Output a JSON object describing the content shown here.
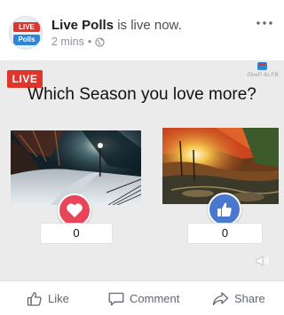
{
  "header": {
    "avatar": {
      "line1": "LIVE",
      "line2": "Polls"
    },
    "page_name": "Live Polls",
    "status_text": " is live now.",
    "time_ago": "2 mins",
    "separator": "•",
    "privacy_icon": "globe-icon",
    "menu_icon": "more-horizontal-icon"
  },
  "stage": {
    "live_badge": "LIVE",
    "watermark_text": "ЛiveP·lls.FB",
    "question": "Which Season you love more?",
    "options": [
      {
        "image": "winter-night-park",
        "reaction_icon": "heart-icon",
        "reaction_color": "#e9455a",
        "count": "0"
      },
      {
        "image": "autumn-river-forest",
        "reaction_icon": "thumbs-up-icon",
        "reaction_color": "#4a78cf",
        "count": "0"
      }
    ],
    "volume_icon": "volume-icon"
  },
  "actions": {
    "like_label": "Like",
    "comment_label": "Comment",
    "share_label": "Share"
  },
  "colors": {
    "live_red": "#e0352b",
    "brand_blue": "#2f86d6",
    "muted_text": "#606770"
  }
}
